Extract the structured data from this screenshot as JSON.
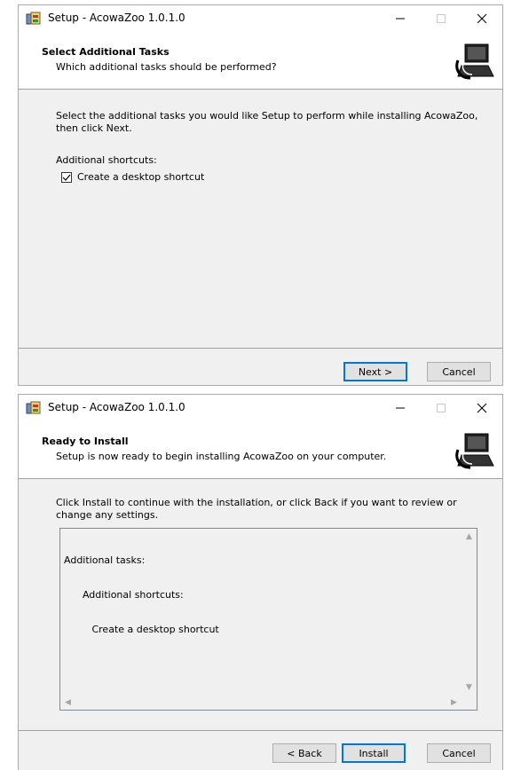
{
  "colors": {
    "accent": "#0078d7",
    "header_bg": "#ffffff",
    "body_bg": "#f0f0f0"
  },
  "window1": {
    "title": "Setup - AcowaZoo 1.0.1.0",
    "header_title": "Select Additional Tasks",
    "header_subtitle": "Which additional tasks should be performed?",
    "description": "Select the additional tasks you would like Setup to perform while installing AcowaZoo, then click Next.",
    "shortcuts_label": "Additional shortcuts:",
    "checkbox_label": "Create a desktop shortcut",
    "checkbox_checked": true,
    "buttons": {
      "next": "Next >",
      "cancel": "Cancel"
    }
  },
  "window2": {
    "title": "Setup - AcowaZoo 1.0.1.0",
    "header_title": "Ready to Install",
    "header_subtitle": "Setup is now ready to begin installing AcowaZoo on your computer.",
    "description": "Click Install to continue with the installation, or click Back if you want to review or change any settings.",
    "memo_lines": [
      "Additional tasks:",
      "      Additional shortcuts:",
      "         Create a desktop shortcut"
    ],
    "buttons": {
      "back": "< Back",
      "install": "Install",
      "cancel": "Cancel"
    }
  },
  "icons": [
    "setup-app-icon",
    "minimize-icon",
    "maximize-icon",
    "close-icon",
    "computer-installer-icon",
    "checkmark-icon"
  ]
}
